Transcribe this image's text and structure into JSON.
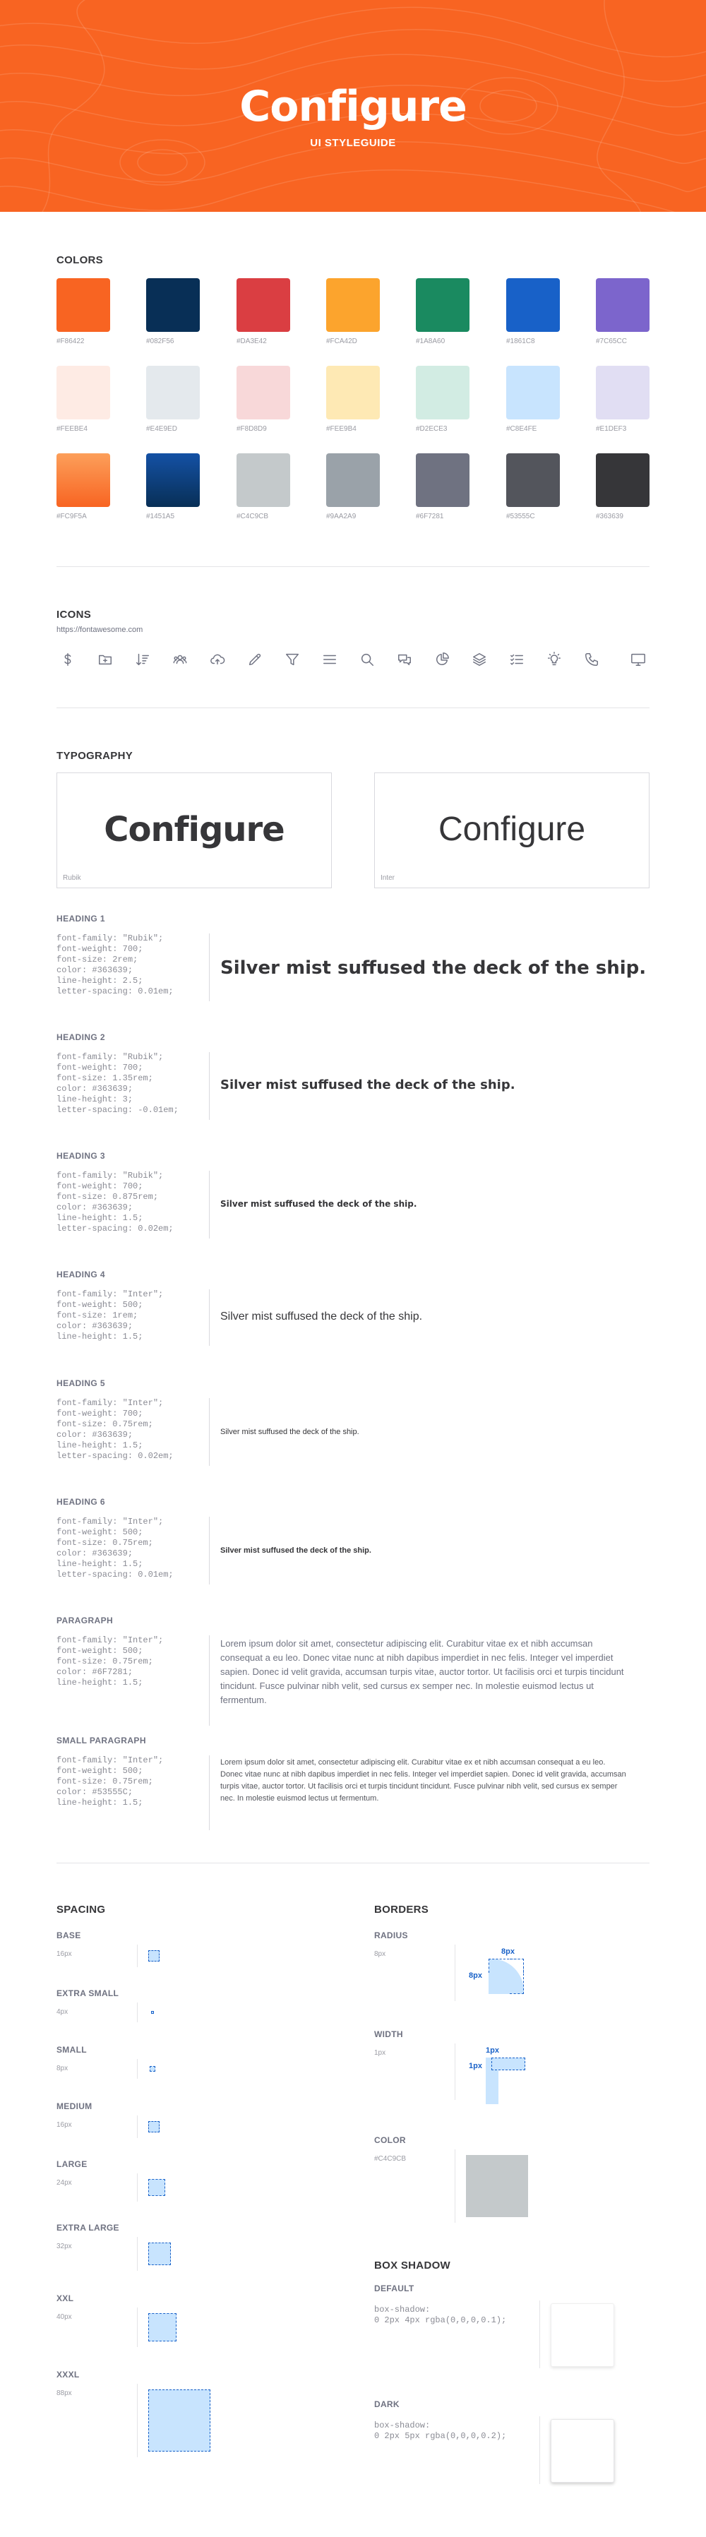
{
  "hero": {
    "title": "Configure",
    "subtitle": "UI STYLEGUIDE",
    "bg": "#F86422"
  },
  "colors": {
    "title": "COLORS",
    "rows": [
      [
        "#F86422",
        "#082F56",
        "#DA3E42",
        "#FCA42D",
        "#1A8A60",
        "#1861C8",
        "#7C65CC"
      ],
      [
        "#FEEBE4",
        "#E4E9ED",
        "#F8D8D9",
        "#FEE9B4",
        "#D2ECE3",
        "#C8E4FE",
        "#E1DEF3"
      ],
      [
        "#FC9F5A",
        "#1451A5",
        "#C4C9CB",
        "#9A A2A9",
        "#6F7281",
        "#53555C",
        "#363639"
      ]
    ],
    "labels": [
      [
        "#F86422",
        "#082F56",
        "#DA3E42",
        "#FCA42D",
        "#1A8A60",
        "#1861C8",
        "#7C65CC"
      ],
      [
        "#FEEBE4",
        "#E4E9ED",
        "#F8D8D9",
        "#FEE9B4",
        "#D2ECE3",
        "#C8E4FE",
        "#E1DEF3"
      ],
      [
        "#FC9F5A",
        "#1451A5",
        "#C4C9CB",
        "#9AA2A9",
        "#6F7281",
        "#53555C",
        "#363639"
      ]
    ],
    "gradients": [
      "#F86422",
      "#082F56"
    ]
  },
  "icons": {
    "title": "ICONS",
    "source": "https://fontawesome.com",
    "items": [
      "dollar-icon",
      "folder-plus-icon",
      "sort-amount-icon",
      "users-icon",
      "cloud-upload-icon",
      "pencil-icon",
      "filter-icon",
      "bars-icon",
      "search-icon",
      "comments-icon",
      "chart-pie-icon",
      "layer-group-icon",
      "list-check-icon",
      "lightbulb-icon",
      "phone-icon",
      "desktop-icon"
    ]
  },
  "typography": {
    "title": "TYPOGRAPHY",
    "fonts": [
      {
        "sample": "Configure",
        "caption": "Rubik"
      },
      {
        "sample": "Configure",
        "caption": "Inter"
      }
    ],
    "styles": [
      {
        "name": "HEADING 1",
        "code": "font-family: \"Rubik\";\nfont-weight: 700;\nfont-size: 2rem;\ncolor: #363639;\nline-height: 2.5;\nletter-spacing: 0.01em;",
        "sample": "Silver mist suffused the deck of the ship."
      },
      {
        "name": "HEADING 2",
        "code": "font-family: \"Rubik\";\nfont-weight: 700;\nfont-size: 1.35rem;\ncolor: #363639;\nline-height: 3;\nletter-spacing: -0.01em;",
        "sample": "Silver mist suffused the deck of the ship."
      },
      {
        "name": "HEADING 3",
        "code": "font-family: \"Rubik\";\nfont-weight: 700;\nfont-size: 0.875rem;\ncolor: #363639;\nline-height: 1.5;\nletter-spacing: 0.02em;",
        "sample": "Silver mist suffused the deck of the ship."
      },
      {
        "name": "HEADING 4",
        "code": "font-family: \"Inter\";\nfont-weight: 500;\nfont-size: 1rem;\ncolor: #363639;\nline-height: 1.5;",
        "sample": "Silver mist suffused the deck of the ship."
      },
      {
        "name": "HEADING 5",
        "code": "font-family: \"Inter\";\nfont-weight: 700;\nfont-size: 0.75rem;\ncolor: #363639;\nline-height: 1.5;\nletter-spacing: 0.02em;",
        "sample": "Silver mist suffused the deck of the ship."
      },
      {
        "name": "HEADING 6",
        "code": "font-family: \"Inter\";\nfont-weight: 500;\nfont-size: 0.75rem;\ncolor: #363639;\nline-height: 1.5;\nletter-spacing: 0.01em;",
        "sample": "Silver mist suffused the deck of the ship."
      },
      {
        "name": "PARAGRAPH",
        "code": "font-family: \"Inter\";\nfont-weight: 500;\nfont-size: 0.75rem;\ncolor: #6F7281;\nline-height: 1.5;",
        "sample": "Lorem ipsum dolor sit amet, consectetur adipiscing elit. Curabitur vitae ex et nibh accumsan consequat a eu leo. Donec vitae nunc at nibh dapibus imperdiet in nec felis. Integer vel imperdiet sapien. Donec id velit gravida, accumsan turpis vitae, auctor tortor. Ut facilisis orci et turpis tincidunt tincidunt. Fusce pulvinar nibh velit, sed cursus ex semper nec. In molestie euismod lectus ut fermentum."
      },
      {
        "name": "SMALL PARAGRAPH",
        "code": "font-family: \"Inter\";\nfont-weight: 500;\nfont-size: 0.75rem;\ncolor: #53555C;\nline-height: 1.5;",
        "sample": "Lorem ipsum dolor sit amet, consectetur adipiscing elit. Curabitur vitae ex et nibh accumsan consequat a eu leo. Donec vitae nunc at nibh dapibus imperdiet in nec felis. Integer vel imperdiet sapien. Donec id velit gravida, accumsan turpis vitae, auctor tortor. Ut facilisis orci et turpis tincidunt tincidunt. Fusce pulvinar nibh velit, sed cursus ex semper nec. In molestie euismod lectus ut fermentum."
      }
    ]
  },
  "spacing": {
    "title": "SPACING",
    "items": [
      {
        "name": "BASE",
        "value": "16px"
      },
      {
        "name": "EXTRA SMALL",
        "value": "4px"
      },
      {
        "name": "SMALL",
        "value": "8px"
      },
      {
        "name": "MEDIUM",
        "value": "16px"
      },
      {
        "name": "LARGE",
        "value": "24px"
      },
      {
        "name": "EXTRA LARGE",
        "value": "32px"
      },
      {
        "name": "XXL",
        "value": "40px"
      },
      {
        "name": "XXXL",
        "value": "88px"
      }
    ]
  },
  "borders": {
    "title": "BORDERS",
    "radius": {
      "name": "RADIUS",
      "value": "8px",
      "label_h": "8px",
      "label_v": "8px"
    },
    "width": {
      "name": "WIDTH",
      "value": "1px",
      "label_h": "1px",
      "label_v": "1px"
    },
    "color": {
      "name": "COLOR",
      "value": "#C4C9CB"
    }
  },
  "box_shadow": {
    "title": "BOX SHADOW",
    "default": {
      "name": "DEFAULT",
      "code": "box-shadow:\n0 2px 4px rgba(0,0,0,0.1);"
    },
    "dark": {
      "name": "DARK",
      "code": "box-shadow:\n0 2px 5px rgba(0,0,0,0.2);"
    }
  }
}
